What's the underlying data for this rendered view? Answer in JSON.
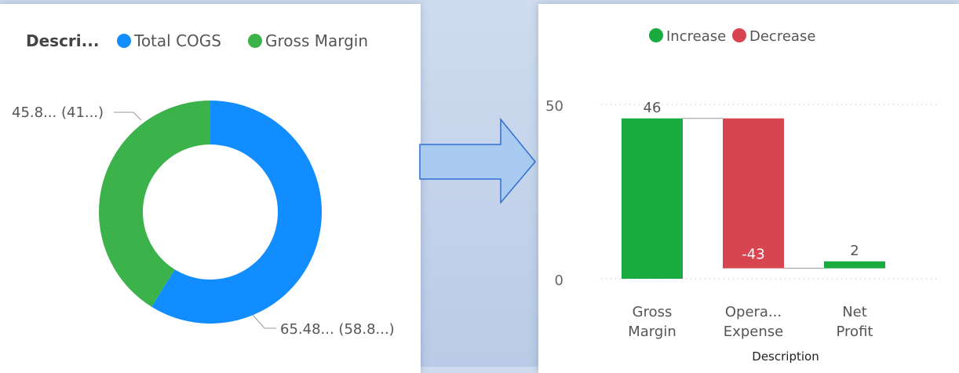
{
  "colors": {
    "cogs": "#118dff",
    "margin": "#3bb34a",
    "increase": "#1aab40",
    "decrease": "#d64550",
    "arrow_fill": "#a9cbf2",
    "arrow_stroke": "#2f6fd1"
  },
  "chart_data": [
    {
      "type": "pie",
      "legend_title": "Descri...",
      "legend": [
        "Total COGS",
        "Gross Margin"
      ],
      "values": [
        65.48,
        45.8
      ],
      "data_labels": [
        "65.48... (58.8...)",
        "45.8... (41...)"
      ],
      "legend_position": "top-left"
    },
    {
      "type": "bar",
      "subtype": "waterfall",
      "legend": [
        "Increase",
        "Decrease"
      ],
      "categories": [
        "Gross Margin",
        "Opera... Expense",
        "Net Profit"
      ],
      "category_lines": [
        [
          "Gross",
          "Margin"
        ],
        [
          "Opera...",
          "Expense"
        ],
        [
          "Net",
          "Profit"
        ]
      ],
      "values": [
        46,
        -43,
        2
      ],
      "data_labels": [
        "46",
        "-43",
        "2"
      ],
      "xlabel": "Description",
      "yticks": [
        0,
        50
      ],
      "ylim": [
        0,
        50
      ],
      "legend_position": "top-center",
      "grid": true
    }
  ]
}
